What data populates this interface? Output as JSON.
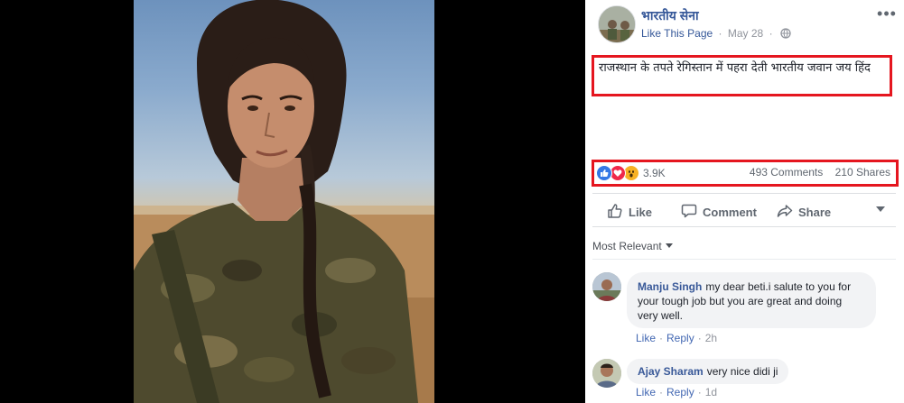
{
  "post": {
    "page_name": "भारतीय सेना",
    "like_page": "Like This Page",
    "date": "May 28",
    "dot": "·",
    "more": "•••",
    "caption": "राजस्थान के तपते रेगिस्तान में पहरा देती भारतीय जवान जय हिंद"
  },
  "stats": {
    "reactions": [
      "like",
      "love",
      "wow"
    ],
    "reaction_count": "3.9K",
    "comments": "493 Comments",
    "shares": "210 Shares"
  },
  "actions": {
    "like": "Like",
    "comment": "Comment",
    "share": "Share"
  },
  "comments_section": {
    "sort_label": "Most Relevant",
    "items": [
      {
        "author": "Manju Singh",
        "text": "my dear beti.i salute to you for your tough job but you are great and doing very well.",
        "like": "Like",
        "reply": "Reply",
        "time": "2h"
      },
      {
        "author": "Ajay Sharam",
        "text": "very nice didi ji",
        "like": "Like",
        "reply": "Reply",
        "time": "1d"
      }
    ]
  },
  "colors": {
    "link_blue": "#365899",
    "highlight_red": "#e5161f",
    "like_blue": "#3578e5",
    "love_red": "#f0284a",
    "wow_yellow": "#f7b125"
  }
}
